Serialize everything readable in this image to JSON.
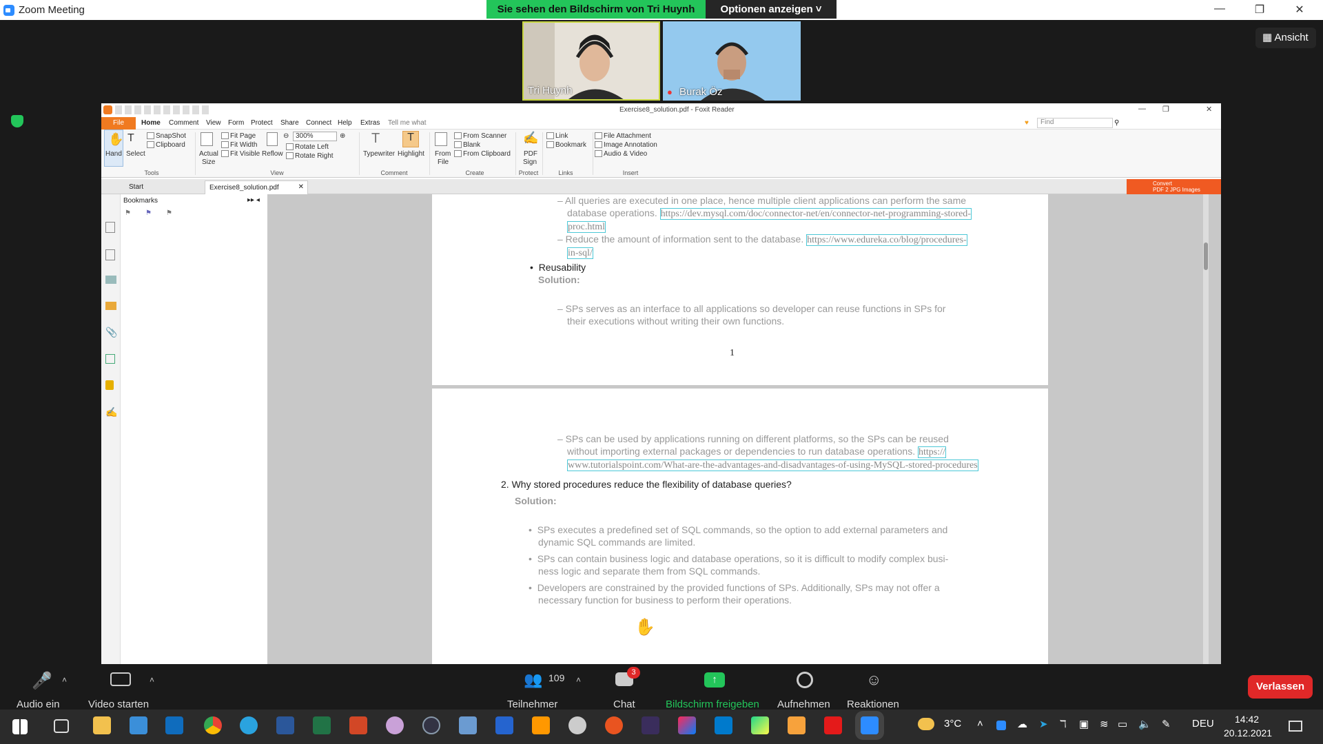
{
  "zoom": {
    "window_title": "Zoom Meeting",
    "share_banner": "Sie sehen den Bildschirm von Tri Huynh",
    "options_label": "Optionen anzeigen",
    "view_label": "Ansicht",
    "participants": [
      {
        "name": "Tri Huynh"
      },
      {
        "name": "Burak Öz"
      }
    ],
    "toolbar": {
      "audio": "Audio ein",
      "video": "Video starten",
      "participants": "Teilnehmer",
      "participants_count": "109",
      "chat": "Chat",
      "chat_badge": "3",
      "share": "Bildschirm freigeben",
      "record": "Aufnehmen",
      "reactions": "Reaktionen",
      "leave": "Verlassen"
    }
  },
  "foxit": {
    "title": "Exercise8_solution.pdf - Foxit Reader",
    "menu": [
      "File",
      "Home",
      "Comment",
      "View",
      "Form",
      "Protect",
      "Share",
      "Connect",
      "Help",
      "Extras",
      "Tell me what"
    ],
    "find_placeholder": "Find",
    "ribbon": {
      "hand": "Hand",
      "select": "Select",
      "snapshot": "SnapShot",
      "clipboard": "Clipboard",
      "actual_size_1": "Actual",
      "actual_size_2": "Size",
      "fit_page": "Fit Page",
      "fit_width": "Fit Width",
      "fit_visible": "Fit Visible",
      "reflow": "Reflow",
      "zoom": "300%",
      "rotate_left": "Rotate Left",
      "rotate_right": "Rotate Right",
      "typewriter": "Typewriter",
      "highlight": "Highlight",
      "from_file_1": "From",
      "from_file_2": "File",
      "from_scanner": "From Scanner",
      "blank": "Blank",
      "from_clipboard": "From Clipboard",
      "pdf_sign_1": "PDF",
      "pdf_sign_2": "Sign",
      "link": "Link",
      "bookmark": "Bookmark",
      "file_attachment": "File Attachment",
      "image_annotation": "Image Annotation",
      "audio_video": "Audio & Video",
      "groups": [
        "Tools",
        "View",
        "Comment",
        "Create",
        "Protect",
        "Links",
        "Insert"
      ]
    },
    "tabs": [
      "Start",
      "Exercise8_solution.pdf"
    ],
    "convert_1": "Convert",
    "convert_2": "PDF 2 JPG Images",
    "bookmarks_title": "Bookmarks"
  },
  "pdf": {
    "l1": "–  All queries are executed in one place, hence multiple client applications can perform the same",
    "l2a": "database operations.",
    "l2b": "https://dev.mysql.com/doc/connector-net/en/connector-net-programming-stored-",
    "l3": "proc.html",
    "l4a": "–  Reduce the amount of information sent to the database.",
    "l4b": "https://www.edureka.co/blog/procedures-",
    "l5": "in-sql/",
    "reuse_title": "Reusability",
    "solution": "Solution:",
    "l6": "–  SPs serves as an interface to all applications so developer can reuse functions in SPs for",
    "l7": "their executions without writing their own functions.",
    "page_num": "1",
    "l8": "–  SPs can be used by applications running on different platforms, so the SPs can be reused",
    "l9a": "without importing external packages or dependencies to run database operations.",
    "l9b": "https://",
    "l10": "www.tutorialspoint.com/What-are-the-advantages-and-disadvantages-of-using-MySQL-stored-procedures",
    "q2": "2.  Why stored procedures reduce the flexibility of database queries?",
    "solution2": "Solution:",
    "b1a": "SPs executes a predefined set of SQL commands, so the option to add external parameters and",
    "b1b": "dynamic SQL commands are limited.",
    "b2a": "SPs can contain business logic and database operations, so it is difficult to modify complex busi-",
    "b2b": "ness logic and separate them from SQL commands.",
    "b3a": "Developers are constrained by the provided functions of SPs.  Additionally, SPs may not offer a",
    "b3b": "necessary function for business to perform their operations."
  },
  "taskbar": {
    "weather": "3°C",
    "lang": "DEU",
    "time": "14:42",
    "date": "20.12.2021"
  }
}
